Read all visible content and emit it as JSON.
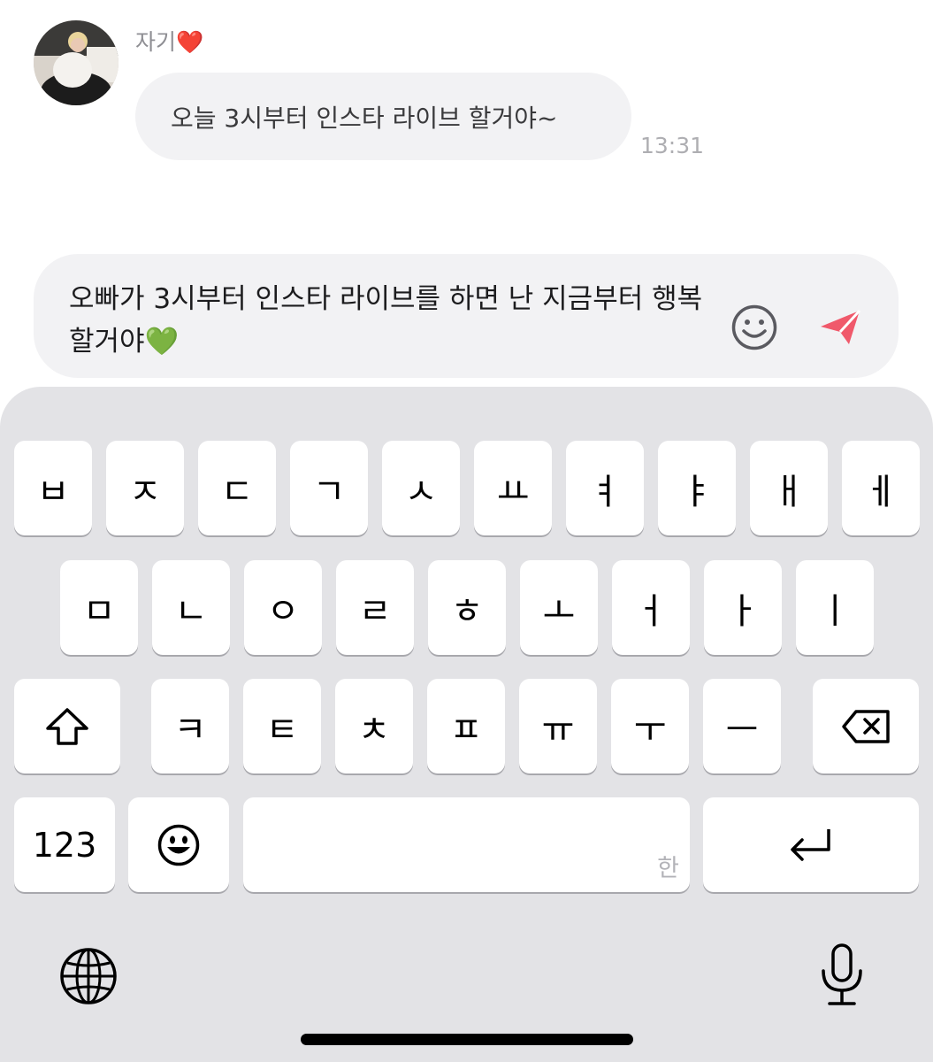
{
  "chat": {
    "sender_name": "자기❤️",
    "message_text": "오늘 3시부터 인스타 라이브 할거야~",
    "message_time": "13:31"
  },
  "compose": {
    "text": "오빠가 3시부터 인스타 라이브를 하면 난 지금부터 행복할거야💚",
    "emoji_button_icon": "smiley-icon",
    "send_button_icon": "paper-plane-icon",
    "send_color": "#f0596b"
  },
  "keyboard": {
    "row1": [
      "ㅂ",
      "ㅈ",
      "ㄷ",
      "ㄱ",
      "ㅅ",
      "ㅛ",
      "ㅕ",
      "ㅑ",
      "ㅐ",
      "ㅔ"
    ],
    "row2": [
      "ㅁ",
      "ㄴ",
      "ㅇ",
      "ㄹ",
      "ㅎ",
      "ㅗ",
      "ㅓ",
      "ㅏ",
      "ㅣ"
    ],
    "row3": [
      "ㅋ",
      "ㅌ",
      "ㅊ",
      "ㅍ",
      "ㅠ",
      "ㅜ",
      "ㅡ"
    ],
    "shift_icon": "shift-arrow-icon",
    "delete_icon": "backspace-icon",
    "numbers_label": "123",
    "emoji_key_icon": "emoji-face-icon",
    "space_hint": "한",
    "return_icon": "return-arrow-icon",
    "globe_icon": "globe-icon",
    "mic_icon": "microphone-icon"
  }
}
